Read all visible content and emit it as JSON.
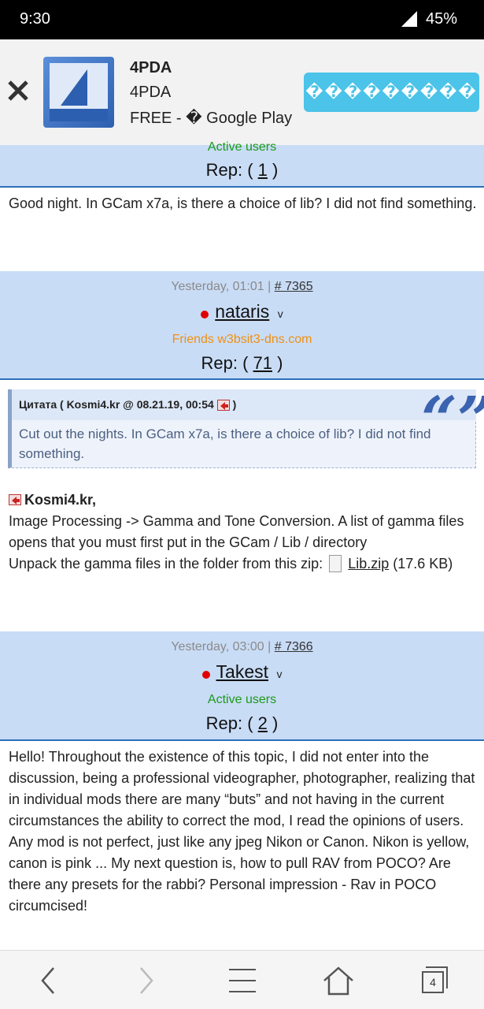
{
  "status": {
    "time": "9:30",
    "battery": "45%"
  },
  "ad": {
    "app_name_bold": "4PDA",
    "app_name": "4PDA",
    "price_line": "FREE - � Google Play",
    "install_label": "���������"
  },
  "posts": [
    {
      "group": "Active users",
      "rep_prefix": "Rep: (",
      "rep_value": "1",
      "rep_suffix": ")",
      "text": "Good night. In GCam x7a, is there a choice of lib? I did not find something."
    },
    {
      "date": "Yesterday, 01:01 |",
      "number": "# 7365",
      "author": "nataris",
      "role": "v",
      "group": "Friends w3bsit3-dns.com",
      "rep_prefix": "Rep: (",
      "rep_value": "71",
      "rep_suffix": ")",
      "quote": {
        "label": "Цитата",
        "source": "( Kosmi4.kr @ 08.21.19, 00:54",
        "close": ")",
        "text": "Cut out the nights. In GCam x7a, is there a choice of lib? I did not find something."
      },
      "reply_to": "Kosmi4.kr,",
      "body1": "Image Processing -> Gamma and Tone Conversion. A list of gamma files opens that you must first put in the GCam / Lib / directory",
      "body2": "Unpack the gamma files in the folder from this zip:",
      "attachment_name": "Lib.zip",
      "attachment_size": "(17.6 KB)"
    },
    {
      "date": "Yesterday, 03:00 |",
      "number": "# 7366",
      "author": "Takest",
      "role": "v",
      "group": "Active users",
      "rep_prefix": "Rep: (",
      "rep_value": "2",
      "rep_suffix": ")",
      "text1": "Hello! Throughout the existence of this topic, I did not enter into the discussion, being a professional videographer, photographer, realizing that in individual mods there are many “buts” and not having in the current circumstances the ability to correct the mod, I read the opinions of users.",
      "text2": "Any mod is not perfect, just like any jpeg Nikon or Canon. Nikon is yellow, canon is pink ... My next question is, how to pull RAV from POCO? Are there any presets for the rabbi? Personal impression - Rav in POCO circumcised!"
    }
  ],
  "nav": {
    "tabs_count": "4"
  }
}
